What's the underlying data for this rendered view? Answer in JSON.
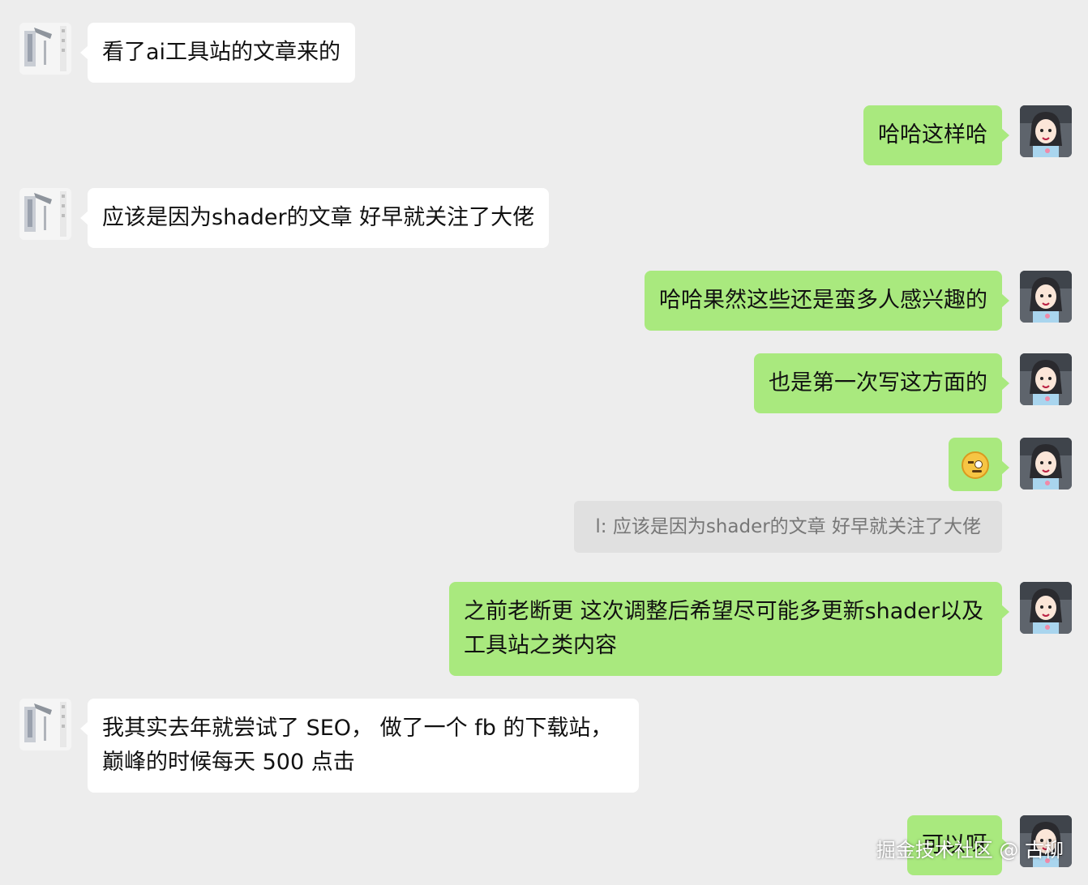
{
  "messages": [
    {
      "text": "看了ai工具站的文章来的"
    },
    {
      "text": "哈哈这样哈"
    },
    {
      "text": "应该是因为shader的文章 好早就关注了大佬"
    },
    {
      "text": "哈哈果然这些还是蛮多人感兴趣的"
    },
    {
      "text": "也是第一次写这方面的"
    },
    {
      "text": "",
      "emoji": "smirk-emoji-icon"
    },
    {
      "text": "之前老断更 这次调整后希望尽可能多更新shader以及工具站之类内容"
    },
    {
      "text": "我其实去年就尝试了 SEO， 做了一个 fb 的下载站，巅峰的时候每天 500 点击"
    },
    {
      "text": "可以呀"
    }
  ],
  "quote": {
    "text": "l: 应该是因为shader的文章 好早就关注了大佬"
  },
  "watermark": "掘金技术社区 @ 古柳",
  "colors": {
    "background": "#ededed",
    "incoming_bubble": "#ffffff",
    "outgoing_bubble": "#a9e97e",
    "quote_bubble": "#e0e0e0"
  }
}
